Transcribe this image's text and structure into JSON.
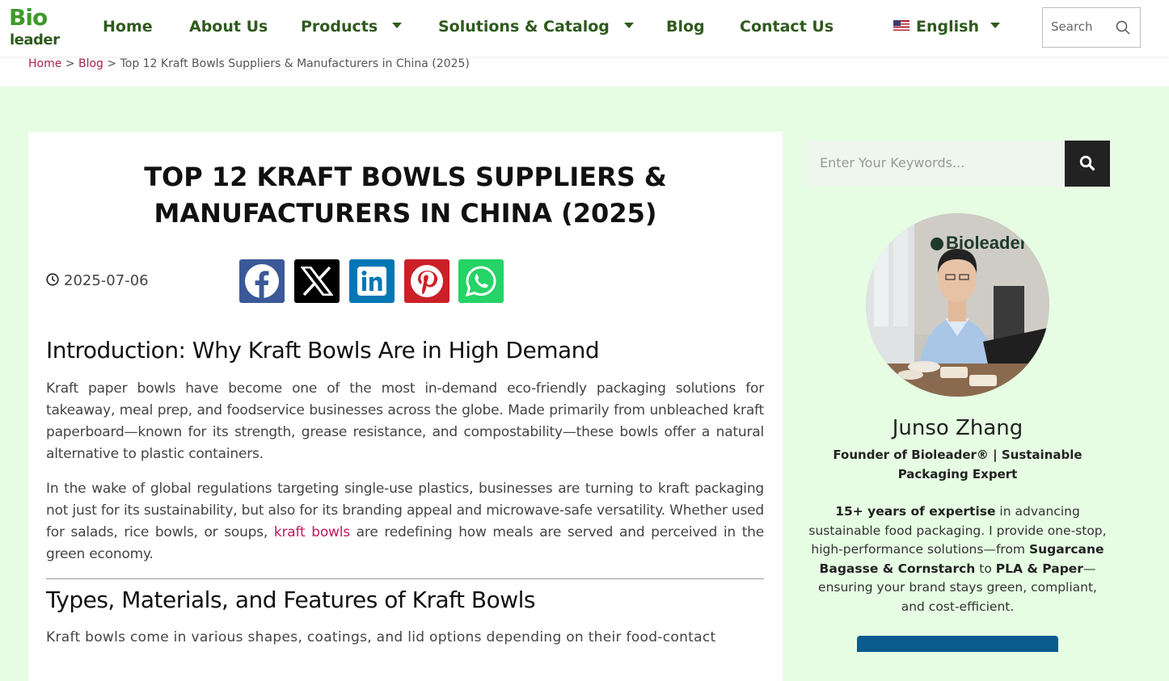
{
  "header": {
    "logo_top": "Bio",
    "logo_bottom": "leader",
    "nav": {
      "home": "Home",
      "about": "About Us",
      "products": "Products",
      "solutions": "Solutions & Catalog",
      "blog": "Blog",
      "contact": "Contact Us",
      "language": "English"
    },
    "search_placeholder": "Search"
  },
  "breadcrumb": {
    "home": "Home",
    "blog": "Blog",
    "sep": ">",
    "current": "Top 12 Kraft Bowls Suppliers & Manufacturers in China (2025)"
  },
  "article": {
    "title_line1": "TOP 12 KRAFT BOWLS SUPPLIERS &",
    "title_line2": "MANUFACTURERS IN CHINA (2025)",
    "date": "2025-07-06",
    "share_icons": [
      "facebook-icon",
      "x-icon",
      "linkedin-icon",
      "pinterest-icon",
      "whatsapp-icon"
    ],
    "h2_intro": "Introduction: Why Kraft Bowls Are in High Demand",
    "p1": "Kraft paper bowls have become one of the most in-demand eco-friendly packaging solutions for takeaway, meal prep, and foodservice businesses across the globe. Made primarily from unbleached kraft paperboard—known for its strength, grease resistance, and compostability—these bowls offer a natural alternative to plastic containers.",
    "p2_before": "In the wake of global regulations targeting single-use plastics, businesses are turning to kraft packaging not just for its sustainability, but also for its branding appeal and microwave-safe versatility. Whether used for salads, rice bowls, or soups, ",
    "p2_link": "kraft bowls",
    "p2_after": " are redefining how meals are served and perceived in the green economy.",
    "h2_types": "Types, Materials, and Features of Kraft Bowls",
    "p3": "Kraft bowls come in various shapes, coatings, and lid options depending on their food-contact"
  },
  "sidebar": {
    "search_placeholder": "Enter Your Keywords...",
    "author_name": "Junso Zhang",
    "author_role_line1": "Founder of Bioleader® | Sustainable",
    "author_role_line2": "Packaging Expert",
    "bio": {
      "b1": "15+ years of expertise",
      "t1": " in advancing sustainable food packaging. I provide one-stop, high-performance solutions—from ",
      "b2": "Sugarcane Bagasse & Cornstarch",
      "t2": " to ",
      "b3": "PLA & Paper",
      "t3": "—ensuring your brand stays green, compliant, and cost-efficient."
    },
    "photo_sign": "Bioleader"
  },
  "colors": {
    "nav_green": "#2f5a1e",
    "logo_green": "#3d9a2a",
    "page_bg": "#e6fde3",
    "link_pink": "#c2185b",
    "facebook": "#3b5998",
    "x": "#000000",
    "linkedin": "#0077b5",
    "pinterest": "#cb2027",
    "whatsapp": "#25d366"
  }
}
